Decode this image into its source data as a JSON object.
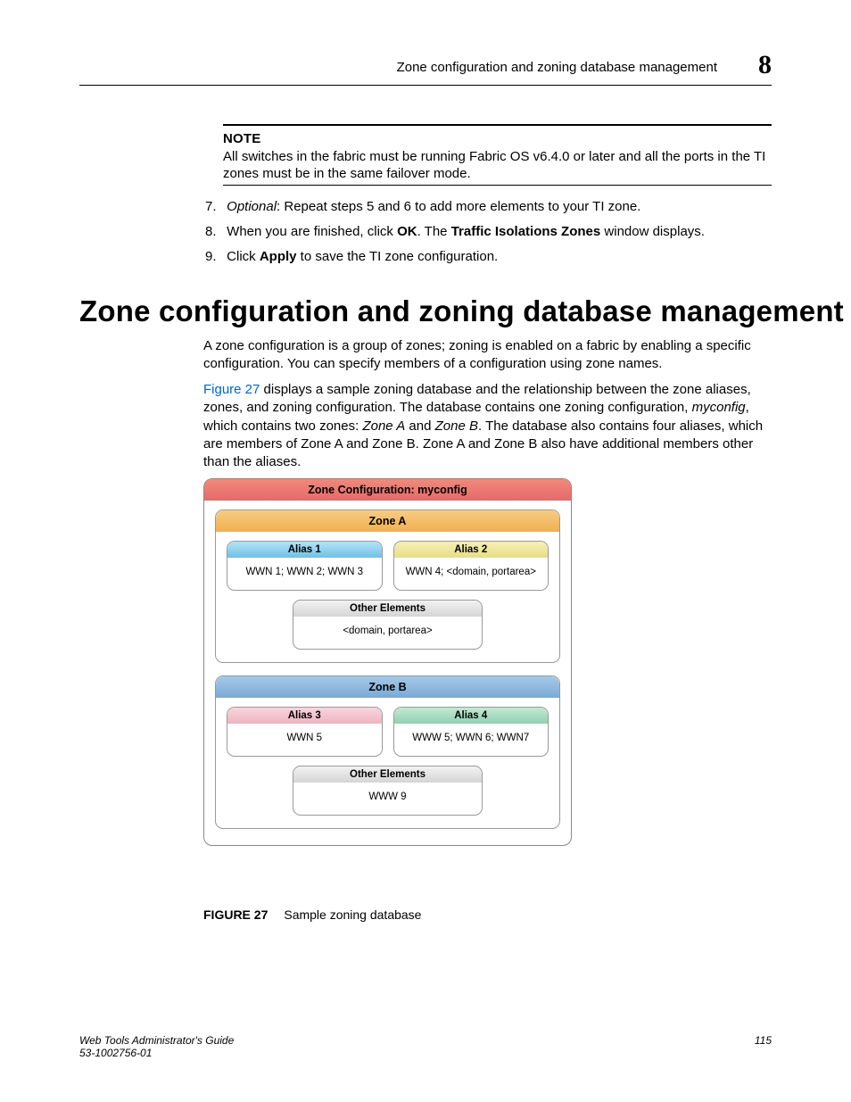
{
  "header": {
    "running_head": "Zone configuration and zoning database management",
    "chapter_number": "8"
  },
  "note": {
    "label": "NOTE",
    "text": "All switches in the fabric must be running Fabric OS v6.4.0 or later and all the ports in the TI zones must be in the same failover mode."
  },
  "steps": {
    "s7": {
      "num": "7.",
      "optional": "Optional",
      "rest": ": Repeat steps 5 and 6 to add more elements to your TI zone."
    },
    "s8": {
      "num": "8.",
      "pre": "When you are finished, click ",
      "ok": "OK",
      "mid": ". The ",
      "win": "Traffic Isolations Zones",
      "post": " window displays."
    },
    "s9": {
      "num": "9.",
      "pre": "Click ",
      "apply": "Apply",
      "post": " to save the TI zone configuration."
    }
  },
  "h1": "Zone configuration and zoning database management",
  "para1": "A zone configuration is a group of zones; zoning is enabled on a fabric by enabling a specific configuration. You can specify members of a configuration using zone names.",
  "para2": {
    "link": "Figure 27",
    "a": " displays a sample zoning database and the relationship between the zone aliases, zones, and zoning configuration. The database contains one zoning configuration, ",
    "myconfig": "myconfig",
    "b": ", which contains two zones: ",
    "za": "Zone A",
    "and": " and ",
    "zb": "Zone B",
    "c": ". The database also contains four aliases, which are members of Zone A and Zone B. Zone A and Zone B also have additional members other than the aliases."
  },
  "diagram": {
    "config_title": "Zone Configuration: myconfig",
    "zoneA": {
      "title": "Zone A",
      "alias1": {
        "title": "Alias 1",
        "body": "WWN 1; WWN 2; WWN 3"
      },
      "alias2": {
        "title": "Alias 2",
        "body": "WWN 4; <domain, portarea>"
      },
      "other": {
        "title": "Other Elements",
        "body": "<domain, portarea>"
      }
    },
    "zoneB": {
      "title": "Zone B",
      "alias3": {
        "title": "Alias 3",
        "body": "WWN 5"
      },
      "alias4": {
        "title": "Alias 4",
        "body": "WWW 5; WWN 6; WWN7"
      },
      "other": {
        "title": "Other Elements",
        "body": "WWW 9"
      }
    }
  },
  "figure_caption": {
    "label": "FIGURE 27",
    "text": "Sample zoning database"
  },
  "footer": {
    "book": "Web Tools Administrator's Guide",
    "docnum": "53-1002756-01",
    "page": "115"
  }
}
